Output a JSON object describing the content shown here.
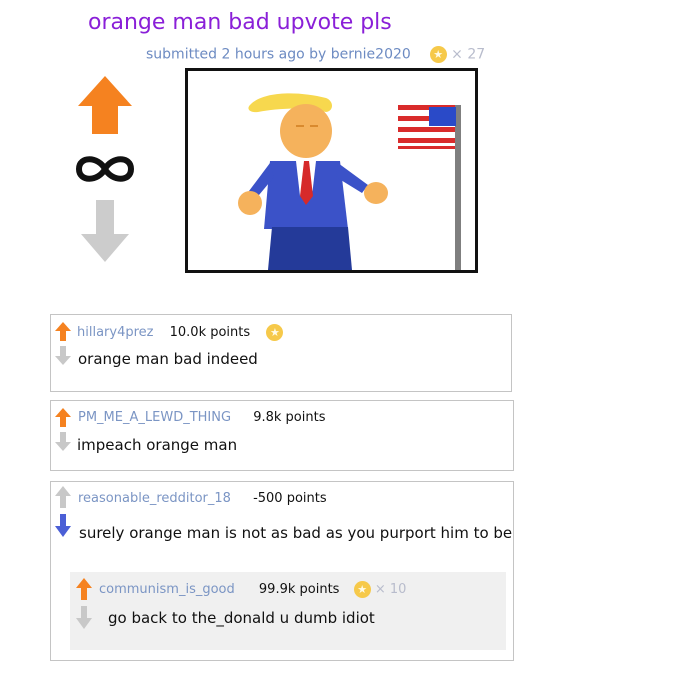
{
  "post": {
    "title": "orange man bad upvote pls",
    "meta": "submitted 2 hours ago by bernie2020",
    "gold_count": "× 27",
    "score": "∞",
    "colors": {
      "title": "#8a1fd8",
      "meta": "#6d8bc2",
      "upvote": "#f58220",
      "downvote": "#cccccc"
    }
  },
  "comments": [
    {
      "author": "hillary4prez",
      "points": "10.0k points",
      "text": "orange man bad indeed",
      "gilded": true
    },
    {
      "author": "PM_ME_A_LEWD_THING",
      "points": "9.8k points",
      "text": "impeach orange man"
    },
    {
      "author": "reasonable_redditor_18",
      "points": "-500 points",
      "text": "surely orange man is not as bad as you purport him to be",
      "reply": {
        "author": "communism_is_good",
        "points": "99.9k points",
        "text": "go back to the_donald u dumb idiot",
        "gold_count": "× 10"
      }
    }
  ]
}
